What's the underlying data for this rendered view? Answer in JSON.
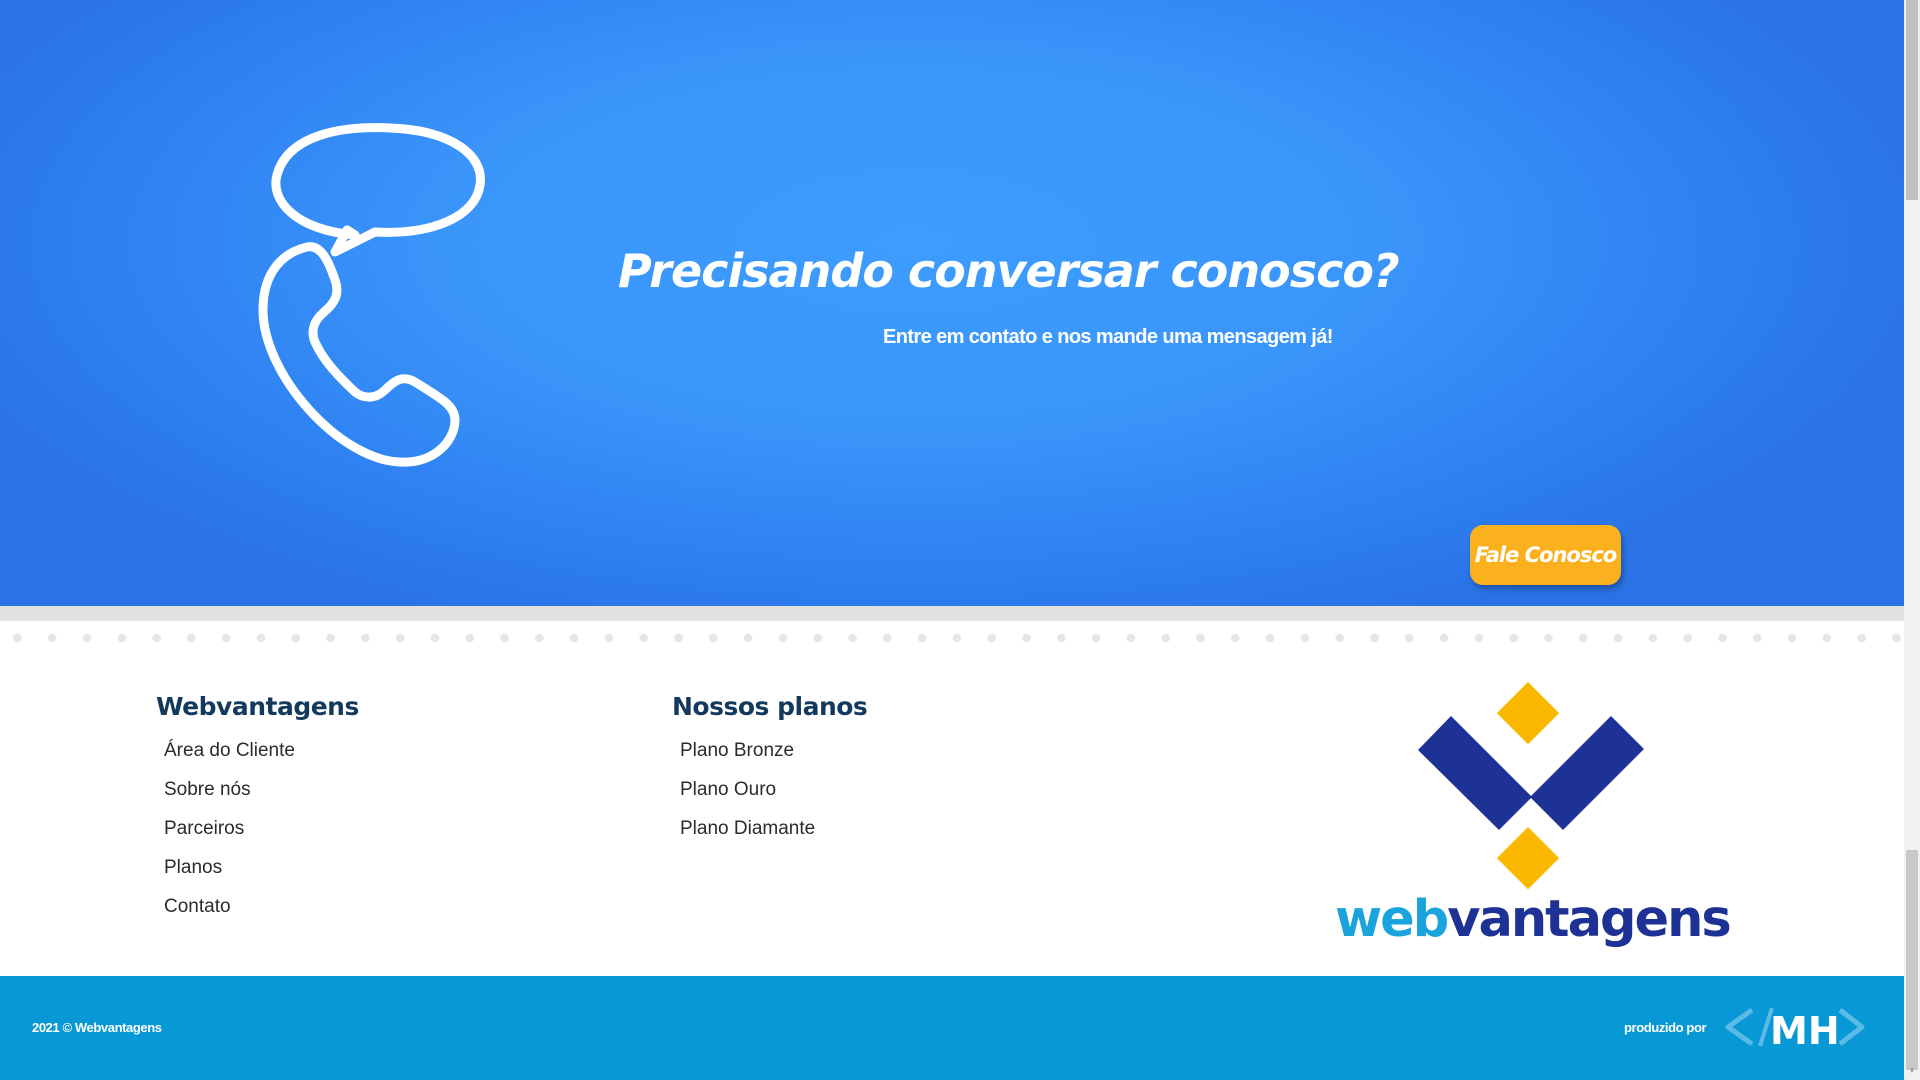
{
  "cta": {
    "title": "Precisando conversar conosco?",
    "subtitle": "Entre em contato e nos mande uma mensagem já!",
    "button_label": "Fale Conosco",
    "icon": "phone-chat-icon"
  },
  "footer": {
    "col1": {
      "heading": "Webvantagens",
      "links": [
        "Área do Cliente",
        "Sobre nós",
        "Parceiros",
        "Planos",
        "Contato"
      ]
    },
    "col2": {
      "heading": "Nossos planos",
      "links": [
        "Plano Bronze",
        "Plano Ouro",
        "Plano Diamante"
      ]
    },
    "logo": {
      "text_web": "web",
      "text_vantagens": "vantagens"
    }
  },
  "bottom_bar": {
    "copyright": "2021 © Webvantagens",
    "producer_label": "produzido por",
    "producer_logo_text": "MH"
  },
  "colors": {
    "cta_blue": "#3a95fa",
    "accent_yellow": "#fbb01d",
    "heading_navy": "#13395c",
    "logo_blue_light": "#1aa3dc",
    "logo_blue_dark": "#1e3295",
    "bottom_bar": "#0898d6"
  }
}
